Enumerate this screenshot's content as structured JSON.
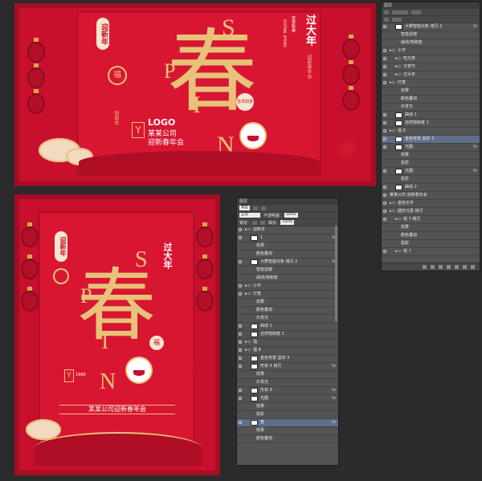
{
  "colors": {
    "poster_red": "#c8102e",
    "dark_red": "#a50d24",
    "gold": "#e8c27a",
    "panel_bg": "#535353",
    "selection": "#5d6f89"
  },
  "poster1": {
    "main_char": "春",
    "letters": [
      "S",
      "P",
      "I",
      "N"
    ],
    "vert_badge": "迎新年",
    "seal": "福",
    "vert_left": "贺新年",
    "title_vert": "过大年",
    "small_vert": "恭贺新春",
    "sub_vert": "迎新春年会",
    "en_vert": "FESTIVAL SPRING",
    "badge": "吉祥如意",
    "logo_mark": "Y",
    "logo": "LOGO",
    "company": "某某公司",
    "event": "迎新春年会"
  },
  "poster2": {
    "main_char": "春",
    "letters": [
      "S",
      "P",
      "I",
      "N"
    ],
    "vert_badge": "迎新年",
    "title_vert": "过大年",
    "badge": "福",
    "logo_mark": "Y",
    "logo_small": "1980",
    "footer": "某某公司迎新春年会"
  },
  "panel1": {
    "title": "图层",
    "layers": [
      {
        "name": "大雾智能对象 拷贝 2",
        "fx": "fx",
        "depth": 2,
        "thumb": true
      },
      {
        "name": "智能滤镜",
        "depth": 3
      },
      {
        "name": "曲线/饱和度",
        "depth": 3
      },
      {
        "name": "小字",
        "depth": 1,
        "group": true
      },
      {
        "name": "吃元宵",
        "depth": 2,
        "group": true
      },
      {
        "name": "元宵节",
        "depth": 2,
        "group": true
      },
      {
        "name": "过大年",
        "depth": 2,
        "group": true
      },
      {
        "name": "灯笼",
        "depth": 1,
        "group": true
      },
      {
        "name": "效果",
        "depth": 3
      },
      {
        "name": "颜色叠加",
        "depth": 3
      },
      {
        "name": "外发光",
        "depth": 3
      },
      {
        "name": "曲线 1",
        "depth": 2,
        "thumb": true
      },
      {
        "name": "自然饱和度 1",
        "depth": 2,
        "thumb": true
      },
      {
        "name": "福 8",
        "depth": 1,
        "group": true
      },
      {
        "name": "金色背景 副本 3",
        "depth": 2,
        "thumb": true,
        "sel": true
      },
      {
        "name": "光圈",
        "fx": "fx",
        "depth": 2,
        "thumb": true
      },
      {
        "name": "效果",
        "depth": 3
      },
      {
        "name": "投影",
        "depth": 3
      },
      {
        "name": "光圈",
        "fx": "fx",
        "depth": 2,
        "thumb": true
      },
      {
        "name": "投影",
        "depth": 3
      },
      {
        "name": "曲线 2",
        "depth": 2,
        "thumb": true
      },
      {
        "name": "某某公司 迎新春年会",
        "depth": 1
      },
      {
        "name": "金色文字",
        "depth": 1,
        "group": true
      },
      {
        "name": "圆形元素 拷贝",
        "depth": 1,
        "group": true
      },
      {
        "name": "组 7 拷贝",
        "depth": 2,
        "group": true
      },
      {
        "name": "效果",
        "depth": 3
      },
      {
        "name": "颜色叠加",
        "depth": 3
      },
      {
        "name": "投影",
        "depth": 3
      },
      {
        "name": "组 7",
        "depth": 2,
        "group": true
      }
    ]
  },
  "panel2": {
    "title": "图层",
    "kind": "类型",
    "blend": "正常",
    "opacity_label": "不透明度:",
    "opacity": "100%",
    "lock_label": "锁定:",
    "fill_label": "填充:",
    "fill": "100%",
    "layers": [
      {
        "name": "迎新年",
        "depth": 1,
        "group": true
      },
      {
        "name": "1",
        "fx": "fx",
        "depth": 2,
        "thumb": true
      },
      {
        "name": "效果",
        "depth": 3
      },
      {
        "name": "颜色叠加",
        "depth": 3
      },
      {
        "name": "大雾智能对象 拷贝 2",
        "fx": "fx",
        "depth": 2,
        "thumb": true
      },
      {
        "name": "智能滤镜",
        "depth": 3
      },
      {
        "name": "曲线/饱和度",
        "depth": 3
      },
      {
        "name": "小字",
        "depth": 1,
        "group": true
      },
      {
        "name": "灯笼",
        "depth": 1,
        "group": true
      },
      {
        "name": "效果",
        "depth": 3
      },
      {
        "name": "颜色叠加",
        "depth": 3
      },
      {
        "name": "外发光",
        "depth": 3
      },
      {
        "name": "曲线 1",
        "depth": 2,
        "thumb": true
      },
      {
        "name": "自然饱和度 1",
        "depth": 2,
        "thumb": true
      },
      {
        "name": "福",
        "depth": 1,
        "group": true
      },
      {
        "name": "福 8",
        "depth": 1,
        "group": true
      },
      {
        "name": "金色背景 副本 3",
        "depth": 2,
        "thumb": true
      },
      {
        "name": "形状 4 拷贝",
        "fx": "fx",
        "depth": 2,
        "thumb": true
      },
      {
        "name": "效果",
        "depth": 3
      },
      {
        "name": "外发光",
        "depth": 3
      },
      {
        "name": "形状 8",
        "fx": "fx",
        "depth": 2,
        "thumb": true
      },
      {
        "name": "光圈",
        "fx": "fx",
        "depth": 2,
        "thumb": true
      },
      {
        "name": "效果",
        "depth": 3
      },
      {
        "name": "投影",
        "depth": 3
      },
      {
        "name": "春",
        "fx": "fx",
        "depth": 2,
        "thumb": true,
        "sel": true
      },
      {
        "name": "效果",
        "depth": 3
      },
      {
        "name": "颜色叠加",
        "depth": 3
      }
    ]
  }
}
